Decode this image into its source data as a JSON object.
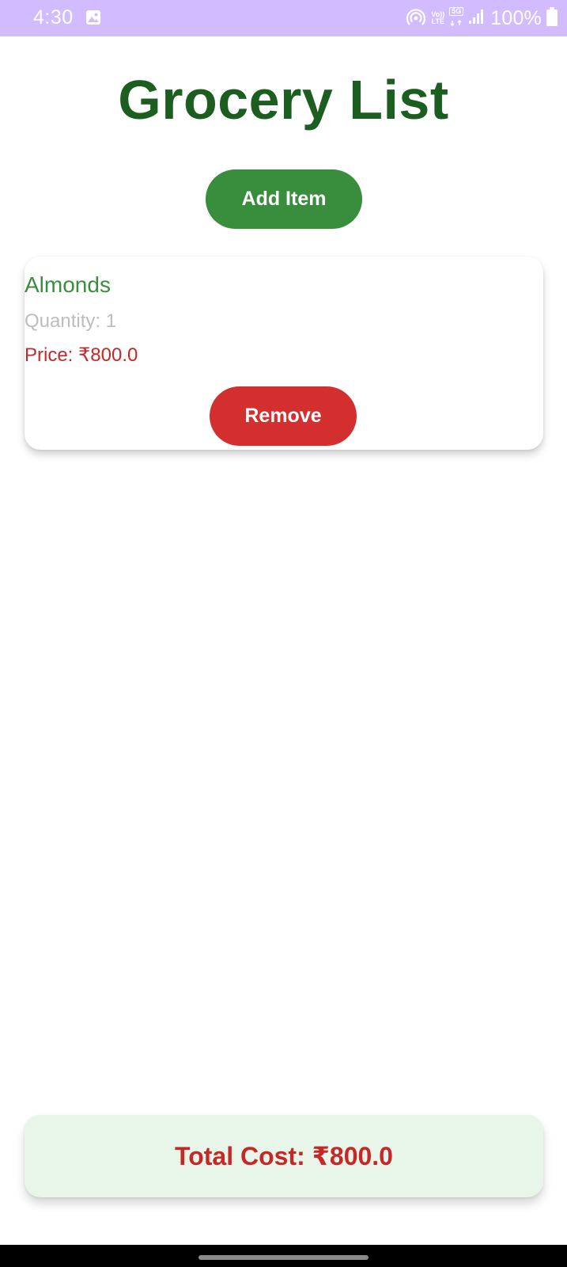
{
  "status_bar": {
    "time": "4:30",
    "network_top": "Vo))",
    "network_bottom": "LTE",
    "net_5g": "5G",
    "battery_text": "100%",
    "background_color": "#d2bcff",
    "icons": [
      "gallery-icon",
      "hotspot-icon",
      "volte-icon",
      "5g-icon",
      "signal-icon",
      "battery-icon"
    ]
  },
  "header": {
    "title": "Grocery List",
    "title_color": "#1b5e20"
  },
  "actions": {
    "add_label": "Add Item",
    "add_color": "#388e3c"
  },
  "items": [
    {
      "name": "Almonds",
      "quantity_text": "Quantity: 1",
      "price_text": "Price: ₹800.0",
      "remove_label": "Remove"
    }
  ],
  "total": {
    "text": "Total Cost: ₹800.0",
    "text_color": "#c62828",
    "background_color": "#e8f5e9"
  },
  "colors": {
    "remove_button": "#d32f2f",
    "item_name": "#388e3c",
    "quantity": "#bdbdbd",
    "price": "#c62828"
  }
}
